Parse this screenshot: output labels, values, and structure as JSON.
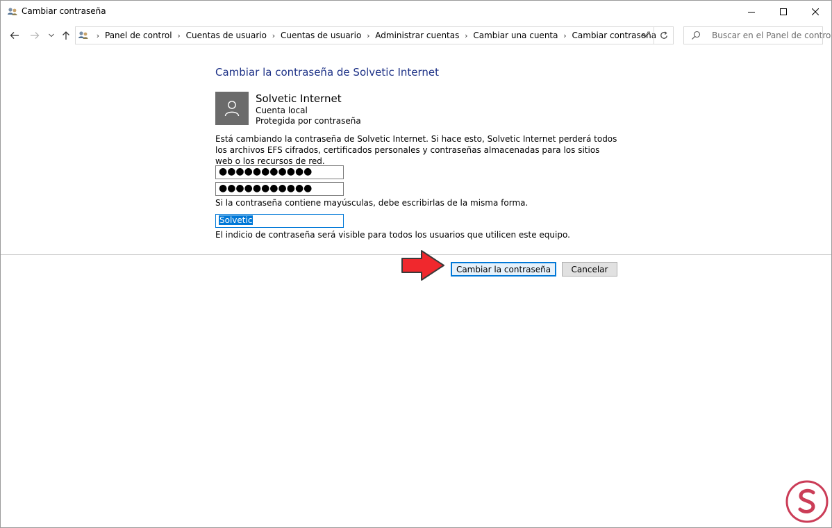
{
  "window": {
    "title": "Cambiar contraseña",
    "minimize_icon": "minimize-icon",
    "maximize_icon": "maximize-icon",
    "close_icon": "close-icon"
  },
  "nav": {
    "back_icon": "arrow-left-icon",
    "forward_icon": "arrow-right-icon",
    "recent_icon": "chevron-down-icon",
    "up_icon": "arrow-up-icon",
    "breadcrumbs": [
      "Panel de control",
      "Cuentas de usuario",
      "Cuentas de usuario",
      "Administrar cuentas",
      "Cambiar una cuenta",
      "Cambiar contraseña"
    ],
    "search_placeholder": "Buscar en el Panel de control"
  },
  "content": {
    "heading": "Cambiar la contraseña de Solvetic Internet",
    "account": {
      "name": "Solvetic Internet",
      "type": "Cuenta local",
      "status": "Protegida por contraseña"
    },
    "warning": "Está cambiando la contraseña de Solvetic Internet. Si hace esto, Solvetic Internet perderá todos los archivos EFS cifrados, certificados personales y contraseñas almacenadas para los sitios web o los recursos de red.",
    "new_password_value": "●●●●●●●●●●●",
    "confirm_password_value": "●●●●●●●●●●●",
    "case_note": "Si la contraseña contiene mayúsculas, debe escribirlas de la misma forma.",
    "hint_value": "Solvetic",
    "hint_note": "El indicio de contraseña será visible para todos los usuarios que utilicen este equipo."
  },
  "actions": {
    "change_label": "Cambiar la contraseña",
    "cancel_label": "Cancelar"
  },
  "colors": {
    "accent": "#0078d7",
    "heading": "#1e3287",
    "annotation_arrow": "#f0282d",
    "watermark": "#c21b3a"
  }
}
